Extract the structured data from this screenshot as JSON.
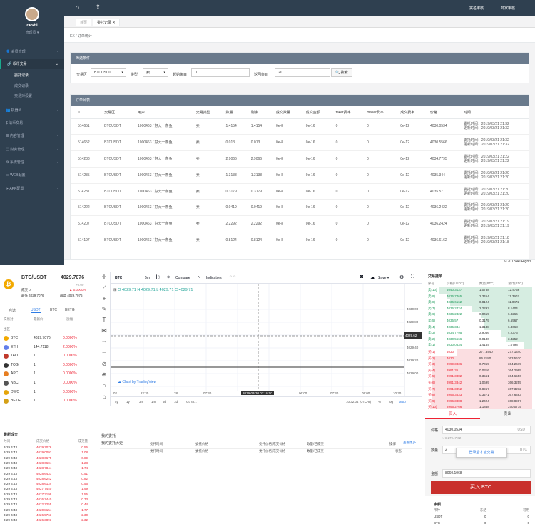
{
  "admin": {
    "user": {
      "name": "ceshi",
      "role": "管理员 ▾"
    },
    "menu": [
      {
        "icon": "user-icon",
        "label": "会员管理"
      },
      {
        "icon": "coin-icon",
        "label": "币币交易",
        "active": true
      },
      {
        "icon": "robot-icon",
        "label": "机器人"
      },
      {
        "icon": "dollar-icon",
        "label": "法币交易"
      },
      {
        "icon": "file-icon",
        "label": "内容管理"
      },
      {
        "icon": "finance-icon",
        "label": "财务管理"
      },
      {
        "icon": "gear-icon",
        "label": "系统管理"
      },
      {
        "icon": "web-icon",
        "label": "WEB配置"
      },
      {
        "icon": "app-icon",
        "label": "APP配置"
      }
    ],
    "submenu": [
      "委托记录",
      "成交记录",
      "交易对设置"
    ],
    "topbar": {
      "realname": "实名审核",
      "merchant": "商家审核"
    },
    "tabs": [
      "首页",
      "委托记录 ✕"
    ],
    "breadcrumb": "EX / 订单统计",
    "filter": {
      "title": "筛选条件",
      "market_label": "交易区",
      "market_value": "BTCUSDT",
      "type_label": "类型",
      "type_value": "卖",
      "start_label": "起始条目",
      "start_value": "0",
      "count_label": "返回条目",
      "count_value": "20",
      "search_btn": "🔍 搜索"
    },
    "orders": {
      "title": "订单列表",
      "headers": [
        "ID",
        "交易区",
        "用户",
        "交易类型",
        "数量",
        "剩余",
        "成交数量",
        "成交金额",
        "taker费率",
        "maker费率",
        "成交费率",
        "价格",
        "时间"
      ],
      "rows": [
        [
          "514651",
          "BTCUSDT",
          "1000463 / 好大一条鱼",
          "卖",
          "1.4154",
          "1.4154",
          "0e-8",
          "0e-16",
          "0",
          "0",
          "0e-12",
          "4030.0534",
          "委托时间：2019/03/21 21:32",
          "更新时间：2019/03/21 21:32"
        ],
        [
          "514652",
          "BTCUSDT",
          "1000463 / 好大一条鱼",
          "卖",
          "0.013",
          "0.013",
          "0e-8",
          "0e-16",
          "0",
          "0",
          "0e-12",
          "4030.5566",
          "委托时间：2019/03/21 21:32",
          "更新时间：2019/03/21 21:32"
        ],
        [
          "514288",
          "BTCUSDT",
          "1000463 / 好大一条鱼",
          "卖",
          "2.9066",
          "2.9066",
          "0e-8",
          "0e-16",
          "0",
          "0",
          "0e-12",
          "4034.7795",
          "委托时间：2019/03/21 21:22",
          "更新时间：2019/03/21 21:22"
        ],
        [
          "514235",
          "BTCUSDT",
          "1000463 / 好大一条鱼",
          "卖",
          "1.3138",
          "1.3138",
          "0e-8",
          "0e-16",
          "0",
          "0",
          "0e-12",
          "4035.344",
          "委托时间：2019/03/21 21:20",
          "更新时间：2019/03/21 21:20"
        ],
        [
          "514231",
          "BTCUSDT",
          "1000463 / 好大一条鱼",
          "卖",
          "0.3179",
          "0.3179",
          "0e-8",
          "0e-16",
          "0",
          "0",
          "0e-12",
          "4035.57",
          "委托时间：2019/03/21 21:20",
          "更新时间：2019/03/21 21:20"
        ],
        [
          "514222",
          "BTCUSDT",
          "1000463 / 好大一条鱼",
          "卖",
          "0.0419",
          "0.0419",
          "0e-8",
          "0e-16",
          "0",
          "0",
          "0e-12",
          "4036.2422",
          "委托时间：2019/03/21 21:20",
          "更新时间：2019/03/21 21:20"
        ],
        [
          "514207",
          "BTCUSDT",
          "1000463 / 好大一条鱼",
          "卖",
          "2.2292",
          "2.2292",
          "0e-8",
          "0e-16",
          "0",
          "0",
          "0e-12",
          "4036.2424",
          "委托时间：2019/03/21 21:19",
          "更新时间：2019/03/21 21:19"
        ],
        [
          "514197",
          "BTCUSDT",
          "1000463 / 好大一条鱼",
          "卖",
          "0.8124",
          "0.8124",
          "0e-8",
          "0e-16",
          "0",
          "0",
          "0e-12",
          "4036.6162",
          "委托时间：2019/03/21 21:18",
          "更新时间：2019/03/21 21:18"
        ]
      ]
    },
    "copyright": "© 2018 All Rights"
  },
  "exchange": {
    "pair": "BTC/USDT",
    "price": "4029.7076",
    "change": "+0.00",
    "change_pct": "▲ 0.0000%",
    "vol_label": "成交 0",
    "high_label": "最高 4029.7076",
    "low_label": "最低 4029.7076",
    "market_tabs": [
      "自选",
      "USDT",
      "BTC",
      "BETG"
    ],
    "market_headers": [
      "交易对",
      "最新价",
      "涨幅"
    ],
    "zone_label": "主区",
    "markets": [
      {
        "sym": "BTC",
        "price": "4029.7076",
        "chg": "0.0000%",
        "color": "#f2a900"
      },
      {
        "sym": "ETH",
        "price": "144.7118",
        "chg": "2.0000%",
        "color": "#627eea"
      },
      {
        "sym": "TAO",
        "price": "1",
        "chg": "0.0000%",
        "color": "#c0392b"
      },
      {
        "sym": "TOG",
        "price": "1",
        "chg": "0.0000%",
        "color": "#333333"
      },
      {
        "sym": "APC",
        "price": "1",
        "chg": "0.0000%",
        "color": "#e67e22"
      },
      {
        "sym": "NBC",
        "price": "1",
        "chg": "0.0000%",
        "color": "#555555"
      },
      {
        "sym": "DWC",
        "price": "1",
        "chg": "0.0000%",
        "color": "#e5a50a"
      },
      {
        "sym": "BETG",
        "price": "1",
        "chg": "0.0000%",
        "color": "#d4a017"
      }
    ],
    "trades_title": "最新成交",
    "trades_headers": [
      "时间",
      "成交价格",
      "成交量"
    ],
    "trades": [
      [
        "3-29 4:43",
        "4029.7076",
        "0.56"
      ],
      [
        "3-29 4:43",
        "4029.0097",
        "1.08"
      ],
      [
        "3-29 4:43",
        "4028.6675",
        "0.89"
      ],
      [
        "3-29 4:43",
        "4028.6604",
        "1.28"
      ],
      [
        "3-29 4:43",
        "4028.7844",
        "1.74"
      ],
      [
        "3-29 4:43",
        "4028.6431",
        "0.51"
      ],
      [
        "3-29 4:43",
        "4028.6242",
        "0.82"
      ],
      [
        "3-29 4:43",
        "4028.6118",
        "0.56"
      ],
      [
        "3-29 4:43",
        "4027.7440",
        "1.99"
      ],
      [
        "3-29 4:43",
        "4027.3199",
        "1.55"
      ],
      [
        "3-29 4:43",
        "4026.7440",
        "0.73"
      ],
      [
        "3-29 4:43",
        "4022.7255",
        "0.44"
      ],
      [
        "3-29 4:43",
        "4020.8154",
        "1.77"
      ],
      [
        "3-29 4:43",
        "4026.5763",
        "2.30"
      ],
      [
        "3-29 4:43",
        "4026.3893",
        "2.32"
      ]
    ],
    "chart": {
      "symbol": "BTC",
      "interval": "5m",
      "compare": "Compare",
      "indicators": "Indicators",
      "save": "Save ▾",
      "ohlc": {
        "o": "O 4029.71",
        "h": "H 4029.71",
        "l": "L 4029.71",
        "c": "C 4029.71"
      },
      "y_ticks": [
        "4030.00",
        "4029.80",
        "4029.60",
        "4029.40",
        "4029.20",
        "4029.00"
      ],
      "last_price": "4029.62",
      "x_ticks": [
        "02",
        "22:30",
        "28",
        "07:30",
        "",
        "",
        "06:00",
        "07:30",
        "09:00",
        "10:30"
      ],
      "cursor_date": "2019-03-30 03:10:00",
      "watermark": "Chart by TradingView",
      "ranges": [
        "5y",
        "1y",
        "3m",
        "1m",
        "5d",
        "1d",
        "Go to..."
      ],
      "time": "10:32:04 (UTC-8)",
      "pct": "%",
      "log": "log",
      "auto": "auto"
    },
    "my_orders": {
      "title": "我的委托",
      "headers": [
        "委托时间",
        "委托价格",
        "委托价格/成交价格",
        "数量/已成交",
        "操作"
      ]
    },
    "history": {
      "title": "我的委托历史",
      "more": "查看更多",
      "headers": [
        "委托时间",
        "委托价格",
        "委托价格/成交价格",
        "数量/已成交",
        "状态"
      ]
    },
    "book": {
      "title": "交易挂单",
      "headers": [
        "序号",
        "价格(USDT)",
        "数量(BTC)",
        "总计(BTC)"
      ],
      "buys": [
        [
          "卖(10)",
          "4040.3137",
          "1.0788",
          "12.4756"
        ],
        [
          "卖(9)",
          "4036.7465",
          "2.3454",
          "11.3902"
        ],
        [
          "卖(8)",
          "4036.6162",
          "0.8124",
          "11.0472"
        ],
        [
          "卖(7)",
          "4036.2424",
          "2.2292",
          "8.1404"
        ],
        [
          "卖(6)",
          "4036.2422",
          "0.0419",
          "6.8266"
        ],
        [
          "卖(5)",
          "4035.57",
          "0.3179",
          "6.5567"
        ],
        [
          "卖(4)",
          "4035.344",
          "1.3138",
          "6.4668"
        ],
        [
          "卖(3)",
          "4034.7795",
          "2.9066",
          "4.2376"
        ],
        [
          "卖(2)",
          "4030.5566",
          "0.0130",
          "3.4252"
        ],
        [
          "卖(1)",
          "4030.0534",
          "1.4154",
          "1.0798"
        ]
      ],
      "sells": [
        [
          "买(1)",
          "4030",
          "277.3440",
          "277.1440"
        ],
        [
          "买(2)",
          "4030",
          "86.2180",
          "363.5620"
        ],
        [
          "买(3)",
          "3999.3336",
          "0.7059",
          "364.2679"
        ],
        [
          "买(4)",
          "3991.36",
          "0.0316",
          "364.2995"
        ],
        [
          "买(5)",
          "3991.3382",
          "0.3561",
          "364.6556"
        ],
        [
          "买(6)",
          "3991.3342",
          "1.0699",
          "366.3255"
        ],
        [
          "买(7)",
          "3991.3352",
          "0.8957",
          "367.3212"
        ],
        [
          "买(8)",
          "3996.3533",
          "0.3271",
          "367.6483"
        ],
        [
          "买(9)",
          "3996.3388",
          "1.2424",
          "368.8907"
        ],
        [
          "买(10)",
          "3996.2766",
          "1.1868",
          "370.0775"
        ]
      ]
    },
    "trade": {
      "buy_tab": "买入",
      "sell_tab": "卖出",
      "price_label": "价格",
      "price": "4030.0534",
      "unit_usdt": "USDT",
      "approx": "≈ ¥ 27947.62",
      "amount_label": "数量",
      "amount": "2",
      "unit_btc": "BTC",
      "login_prompt": "登录后才能交易",
      "total_label": "金额",
      "total": "8060.1068",
      "buy_btn": "买入 BTC"
    },
    "balance": {
      "title": "余额",
      "headers": [
        "币种",
        "冻结",
        "可用"
      ],
      "rows": [
        [
          "USDT",
          "0",
          "0"
        ],
        [
          "BTC",
          "0",
          "0"
        ]
      ]
    }
  }
}
